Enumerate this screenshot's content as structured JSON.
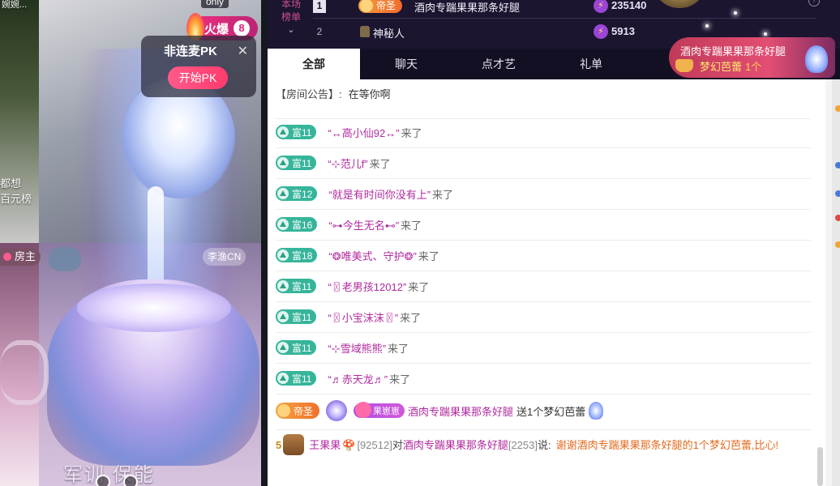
{
  "video": {
    "top_name": "婉婉...",
    "overlay_line1": "都想",
    "overlay_line2": "百元榜",
    "bottom_text": "军训 保能",
    "only_label": "only",
    "hot_label": "火爆",
    "hot_count": "8",
    "pk": {
      "title": "非连麦PK",
      "close_glyph": "✕",
      "button": "开始PK"
    },
    "host_label": "房主",
    "cohost_label": "李渔CN"
  },
  "rank": {
    "label": "本场榜单",
    "chevron": "⌄",
    "help_glyph": "?",
    "rows": [
      {
        "rank": "1",
        "badge": "帝圣",
        "name": "酒肉专踹果果那条好腿",
        "score": "235140"
      },
      {
        "rank": "2",
        "name": "神秘人",
        "score": "5913"
      }
    ]
  },
  "tabs": [
    "全部",
    "聊天",
    "点才艺",
    "礼单"
  ],
  "gift_notice": {
    "sender": "酒肉专踹果果那条好腿",
    "gift": "梦幻芭蕾",
    "count": "1个"
  },
  "chat": {
    "announcement": {
      "label": "【房间公告】:",
      "text": "在等你啊"
    },
    "join_suffix": "来了",
    "joins": [
      {
        "level": "富11",
        "name": "“↔高小仙92↔”"
      },
      {
        "level": "富11",
        "name": "“⊹范儿f”"
      },
      {
        "level": "富12",
        "name": "“就是有时间你没有上”"
      },
      {
        "level": "富16",
        "name": "“⊶今生无名⊷”"
      },
      {
        "level": "富18",
        "name": "“❂唯美式、守护❂”"
      },
      {
        "level": "富11",
        "name": "“〿老男孩12012”"
      },
      {
        "level": "富11",
        "name": "“〿小宝沫沫〿”"
      },
      {
        "level": "富11",
        "name": "“⊹雪域熊熊”"
      },
      {
        "level": "富11",
        "name": "“♬赤天龙♬”"
      }
    ],
    "gift": {
      "badge": "帝圣",
      "fan_badge": "果崽崽",
      "sender": "酒肉专踹果果那条好腿",
      "action": "送1个梦幻芭蕾"
    },
    "message": {
      "level": "5",
      "user": "王果果",
      "mushroom": "🍄",
      "room": "[92512]",
      "to": "对",
      "target": "酒肉专踹果果那条好腿",
      "target_room": "[2253]",
      "say": "说:",
      "content": "谢谢酒肉专踹果果那条好腿的1个梦幻芭蕾,比心!"
    }
  }
}
